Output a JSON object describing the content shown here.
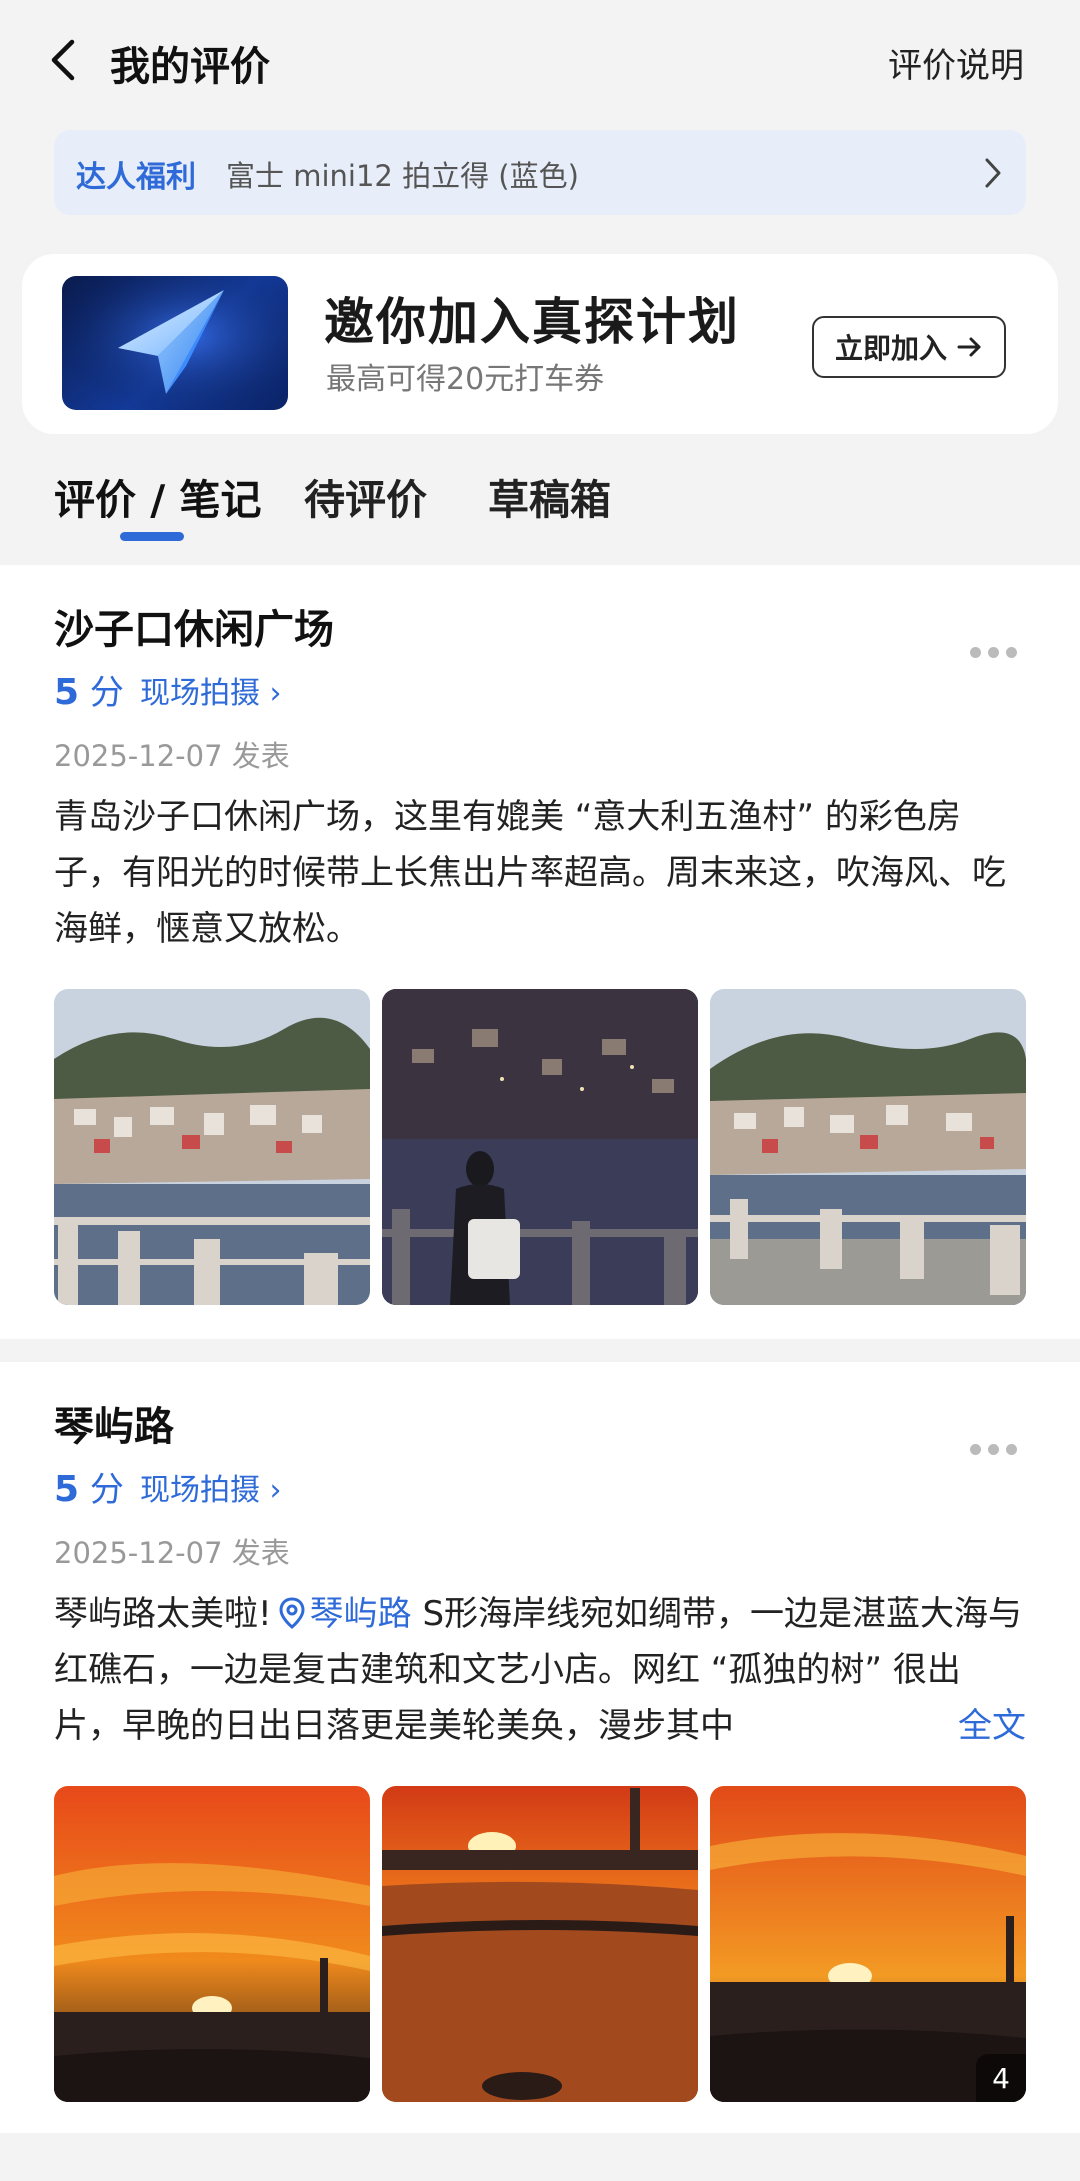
{
  "header": {
    "title": "我的评价",
    "explain": "评价说明"
  },
  "perk": {
    "tag": "达人福利",
    "text": "富士 mini12 拍立得 (蓝色)"
  },
  "invite": {
    "title": "邀你加入真探计划",
    "subtitle": "最高可得20元打车券",
    "button": "立即加入"
  },
  "tabs": [
    "评价 / 笔记",
    "待评价",
    "草稿箱"
  ],
  "reviews": [
    {
      "place": "沙子口休闲广场",
      "score": "5",
      "score_unit": "分",
      "tag": "现场拍摄",
      "date": "2025-12-07 发表",
      "text": "青岛沙子口休闲广场，这里有媲美 “意大利五渔村” 的彩色房子，有阳光的时候带上长焦出片率超高。周末来这，吹海风、吃海鲜，惬意又放松。"
    },
    {
      "place": "琴屿路",
      "score": "5",
      "score_unit": "分",
      "tag": "现场拍摄",
      "date": "2025-12-07 发表",
      "text_before": "琴屿路太美啦!",
      "location": "琴屿路",
      "text_after": " S形海岸线宛如绸带，一边是湛蓝大海与红礁石，一边是复古建筑和文艺小店。网红 “孤独的树” 很出片，早晚的日出日落更是美轮美奂，漫步其中",
      "fulltext": "全文",
      "photo_count": "4"
    }
  ]
}
